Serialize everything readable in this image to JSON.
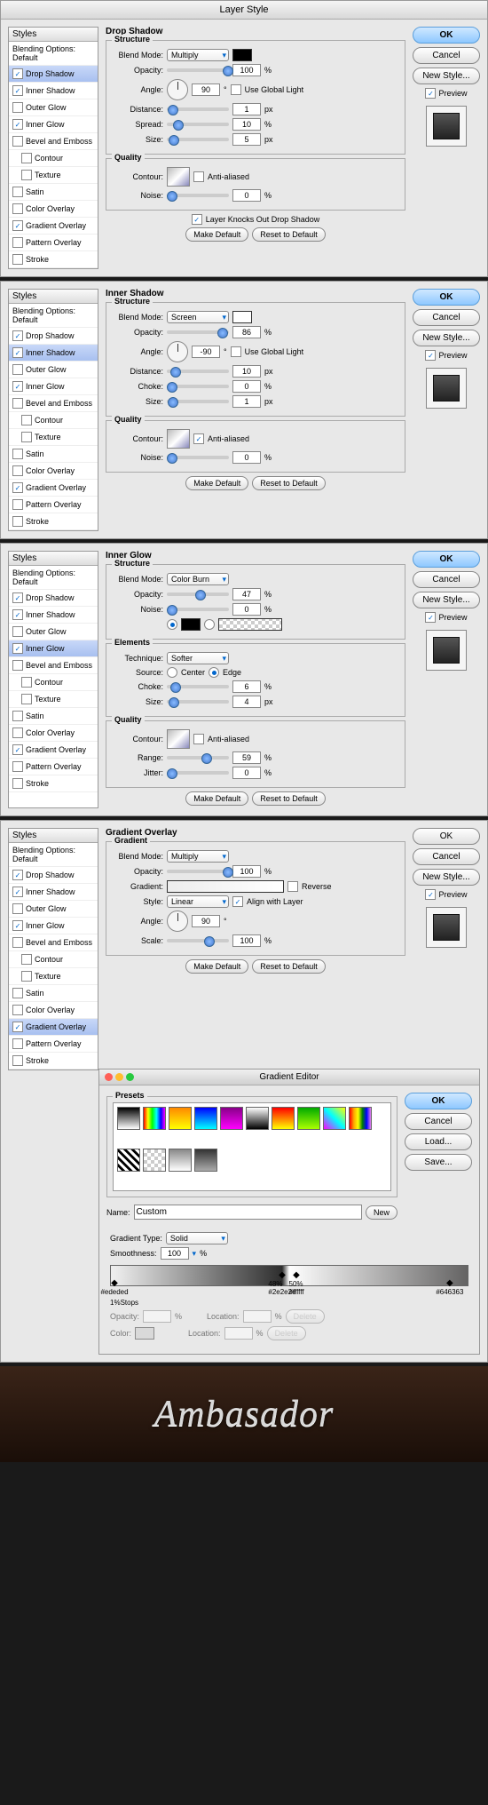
{
  "titlebar": "Layer Style",
  "sidebar": {
    "header": "Styles",
    "blending": "Blending Options: Default",
    "items": [
      "Drop Shadow",
      "Inner Shadow",
      "Outer Glow",
      "Inner Glow",
      "Bevel and Emboss",
      "Contour",
      "Texture",
      "Satin",
      "Color Overlay",
      "Gradient Overlay",
      "Pattern Overlay",
      "Stroke"
    ]
  },
  "buttons": {
    "ok": "OK",
    "cancel": "Cancel",
    "newstyle": "New Style...",
    "preview": "Preview",
    "makedef": "Make Default",
    "reset": "Reset to Default",
    "load": "Load...",
    "save": "Save...",
    "new": "New",
    "delete": "Delete"
  },
  "labels": {
    "blendmode": "Blend Mode:",
    "opacity": "Opacity:",
    "angle": "Angle:",
    "useglobal": "Use Global Light",
    "distance": "Distance:",
    "spread": "Spread:",
    "size": "Size:",
    "contour": "Contour:",
    "anti": "Anti-aliased",
    "noise": "Noise:",
    "knocks": "Layer Knocks Out Drop Shadow",
    "choke": "Choke:",
    "technique": "Technique:",
    "source": "Source:",
    "center": "Center",
    "edge": "Edge",
    "range": "Range:",
    "jitter": "Jitter:",
    "gradient": "Gradient:",
    "reverse": "Reverse",
    "style": "Style:",
    "align": "Align with Layer",
    "scale": "Scale:",
    "name": "Name:",
    "gradtype": "Gradient Type:",
    "smooth": "Smoothness:",
    "stops": "Stops",
    "location": "Location:",
    "color": "Color:"
  },
  "sections": {
    "structure": "Structure",
    "quality": "Quality",
    "elements": "Elements",
    "dropshadow": "Drop Shadow",
    "innershadow": "Inner Shadow",
    "innerglow": "Inner Glow",
    "gradoverlay": "Gradient Overlay",
    "gradient": "Gradient",
    "presets": "Presets"
  },
  "ds": {
    "mode": "Multiply",
    "opacity": "100",
    "angle": "90",
    "distance": "1",
    "spread": "10",
    "size": "5",
    "noise": "0"
  },
  "is": {
    "mode": "Screen",
    "opacity": "86",
    "angle": "-90",
    "distance": "10",
    "choke": "0",
    "size": "1",
    "noise": "0"
  },
  "ig": {
    "mode": "Color Burn",
    "opacity": "47",
    "noise": "0",
    "technique": "Softer",
    "choke": "6",
    "size": "4",
    "range": "59",
    "jitter": "0"
  },
  "go": {
    "mode": "Multiply",
    "opacity": "100",
    "style": "Linear",
    "angle": "90",
    "scale": "100"
  },
  "ge": {
    "title": "Gradient Editor",
    "name": "Custom",
    "type": "Solid",
    "smooth": "100",
    "stops": [
      {
        "pos": "1%",
        "color": "#ededed"
      },
      {
        "pos": "48%",
        "color": "#2e2e2e"
      },
      {
        "pos": "50%",
        "color": "#ffffff"
      },
      {
        "pos": "",
        "color": "#646363"
      }
    ]
  },
  "units": {
    "pct": "%",
    "px": "px",
    "deg": "°"
  },
  "result": "Ambasador"
}
